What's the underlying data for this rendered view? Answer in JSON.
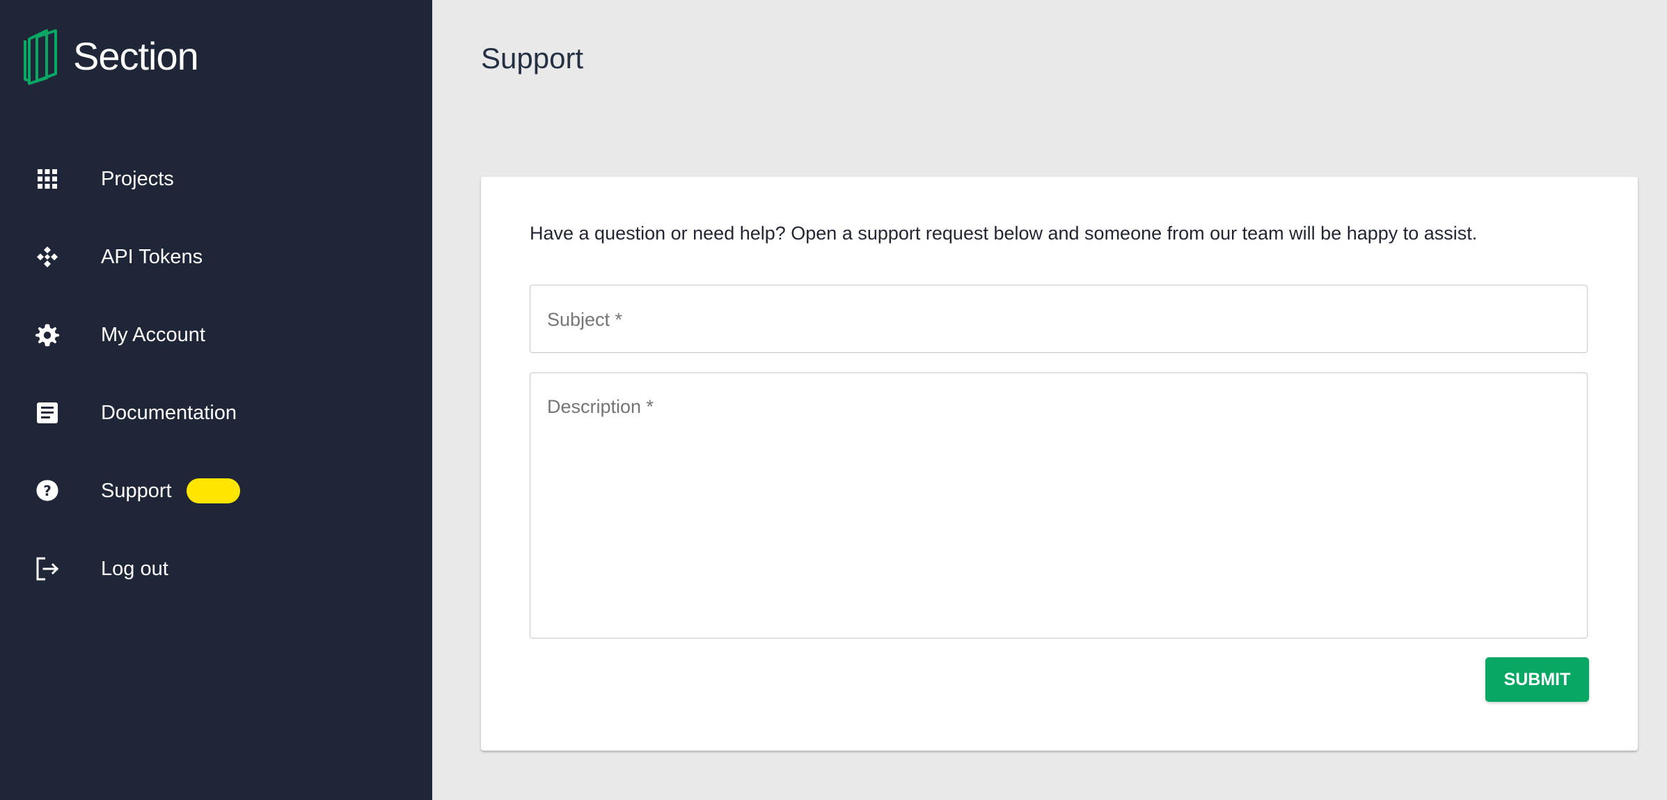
{
  "brand": {
    "name": "Section",
    "logo_icon": "section-logo-icon",
    "accent_color": "#08a864"
  },
  "sidebar": {
    "background": "#1f2637",
    "items": [
      {
        "label": "Projects",
        "icon": "grid-icon"
      },
      {
        "label": "API Tokens",
        "icon": "token-icon"
      },
      {
        "label": "My Account",
        "icon": "gear-icon"
      },
      {
        "label": "Documentation",
        "icon": "document-icon"
      },
      {
        "label": "Support",
        "icon": "help-icon",
        "badge_color": "#ffe600"
      },
      {
        "label": "Log out",
        "icon": "logout-icon"
      }
    ]
  },
  "main": {
    "title": "Support",
    "intro": "Have a question or need help? Open a support request below and someone from our team will be happy to assist.",
    "subject_label": "Subject *",
    "description_label": "Description *",
    "submit_label": "SUBMIT",
    "submit_color": "#08a864"
  }
}
